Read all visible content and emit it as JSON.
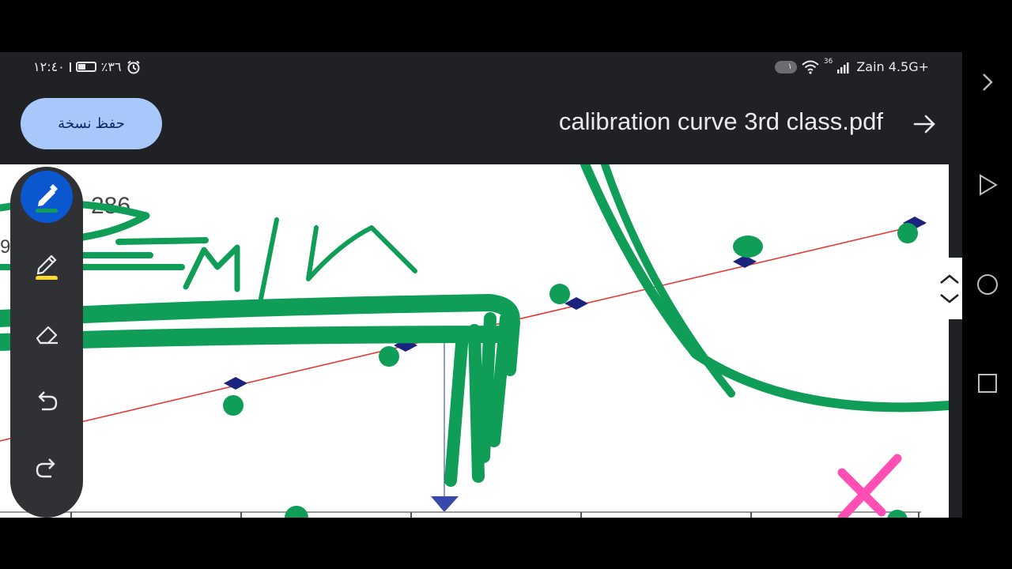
{
  "status": {
    "time": "١٢:٤٠",
    "battery_percent": "٪٣٦",
    "vpn_badge": "١",
    "network_type": "36",
    "carrier": "Zain 4.5G+"
  },
  "header": {
    "save_copy_label": "حفظ نسخة",
    "title": "calibration curve 3rd class.pdf"
  },
  "document": {
    "fragment_text": "286",
    "fragment_text_2": "9"
  },
  "colors": {
    "accent": "#0b57d0",
    "button_bg": "#a8c7fa",
    "pen_green": "#0f9d58",
    "highlighter_yellow": "#fdd835",
    "eraser_mark": "#ff4fb4",
    "trendline": "#e53935",
    "marker": "#1a237e"
  },
  "toolbar": {
    "tools": [
      "pen-icon",
      "highlighter-icon",
      "eraser-icon",
      "undo-icon",
      "redo-icon"
    ]
  }
}
